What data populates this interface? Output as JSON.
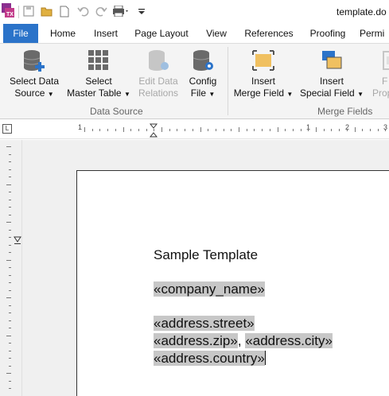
{
  "window": {
    "title": "template.do"
  },
  "quick_access": {
    "items": [
      "save-icon",
      "open-icon",
      "new-icon",
      "undo-icon",
      "redo-icon",
      "print-icon",
      "customize-icon"
    ]
  },
  "tabs": [
    {
      "label": "File"
    },
    {
      "label": "Home"
    },
    {
      "label": "Insert"
    },
    {
      "label": "Page Layout"
    },
    {
      "label": "View"
    },
    {
      "label": "References"
    },
    {
      "label": "Proofing"
    },
    {
      "label": "Permi"
    }
  ],
  "ribbon": {
    "data_source": {
      "group_label": "Data Source",
      "select_data_source": {
        "line1": "Select Data",
        "line2": "Source"
      },
      "select_master_table": {
        "line1": "Select",
        "line2": "Master Table"
      },
      "edit_data_relations": {
        "line1": "Edit Data",
        "line2": "Relations"
      },
      "config_file": {
        "line1": "Config",
        "line2": "File"
      }
    },
    "merge_fields": {
      "group_label": "Merge Fields",
      "insert_merge_field": {
        "line1": "Insert",
        "line2": "Merge Field"
      },
      "insert_special_field": {
        "line1": "Insert",
        "line2": "Special Field"
      },
      "field_properties": {
        "line1": "F",
        "line2": "Prop"
      }
    }
  },
  "ruler": {
    "corner": "L",
    "numbers": [
      "1",
      "1",
      "2",
      "3"
    ]
  },
  "document": {
    "heading": "Sample Template",
    "company_field": "«company_name»",
    "street_field": "«address.street»",
    "zip_field": "«address.zip»",
    "separator": ",",
    "city_field": "«address.city»",
    "country_field": "«address.country»"
  },
  "colors": {
    "file_tab": "#2b73c9",
    "field_highlight": "#c7c7c7",
    "ribbon_bg": "#f4f4f4"
  }
}
